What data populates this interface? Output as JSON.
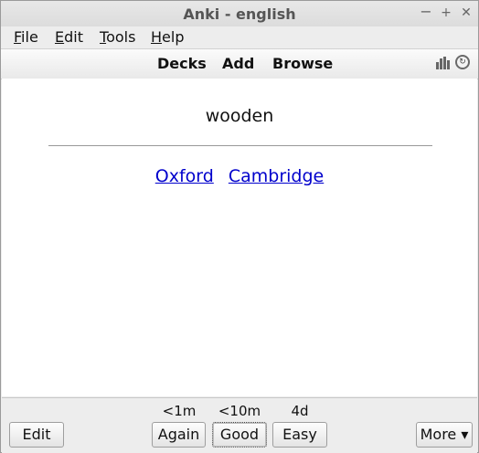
{
  "window": {
    "title": "Anki - english",
    "controls": {
      "minimize": "−",
      "maximize": "+",
      "close": "✕"
    }
  },
  "menu": [
    {
      "key": "F",
      "rest": "ile"
    },
    {
      "key": "E",
      "rest": "dit"
    },
    {
      "key": "T",
      "rest": "ools"
    },
    {
      "key": "H",
      "rest": "elp"
    }
  ],
  "toolbar": {
    "decks": "Decks",
    "add": "Add",
    "browse": "Browse",
    "icons": [
      "stats-icon",
      "sync-icon"
    ]
  },
  "card": {
    "front": "wooden",
    "links": [
      "Oxford",
      "Cambridge"
    ]
  },
  "answer_bar": {
    "edit": "Edit",
    "intervals": [
      "<1m",
      "<10m",
      "4d"
    ],
    "buttons": [
      "Again",
      "Good",
      "Easy"
    ],
    "more": "More ▾"
  }
}
